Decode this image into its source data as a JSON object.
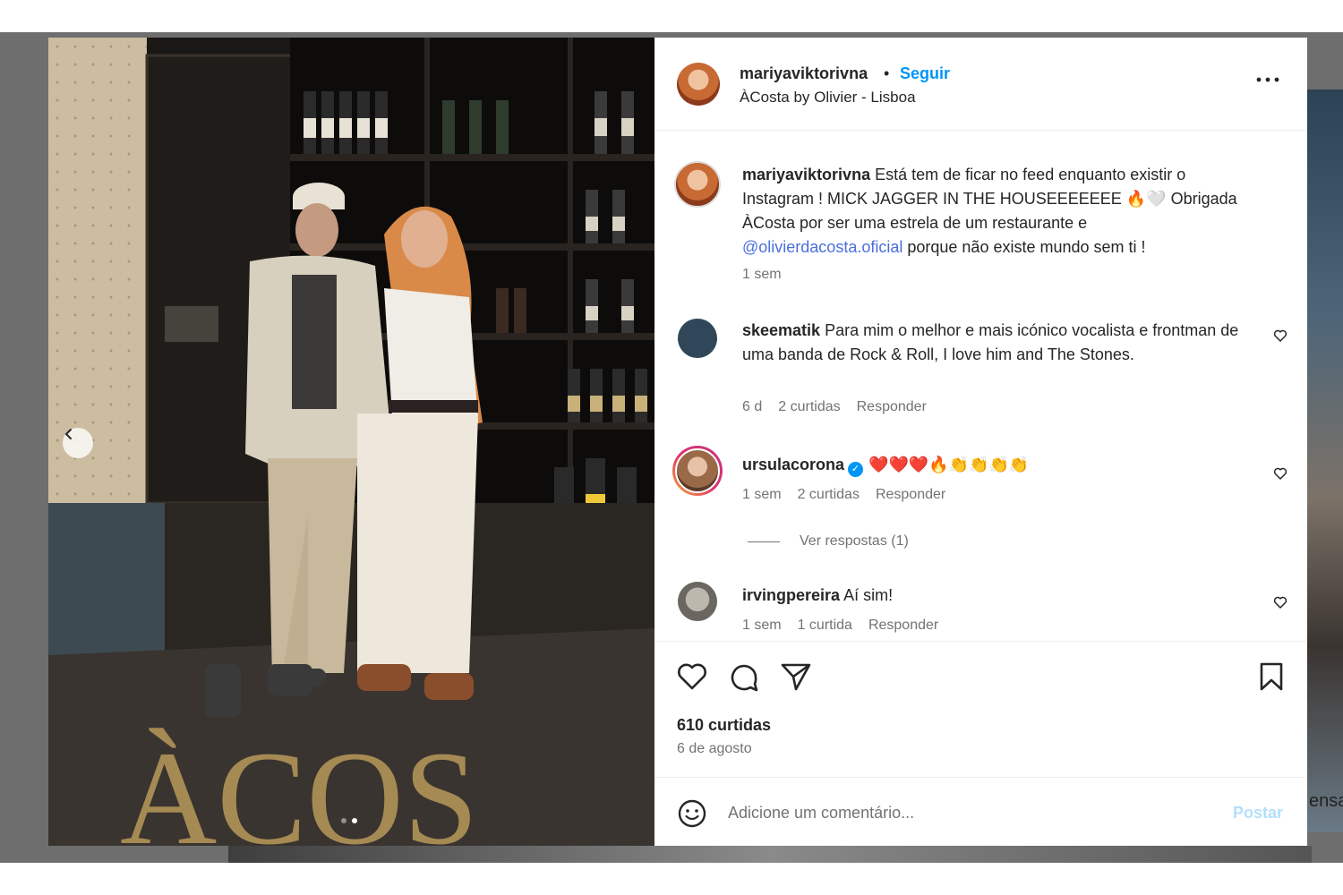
{
  "post": {
    "username": "mariyaviktorivna",
    "separator": "•",
    "follow_label": "Seguir",
    "location": "ÀCosta by Olivier - Lisboa",
    "more_icon": "more-horizontal-icon",
    "photo_sign_text": "ÀCOS",
    "carousel_total": 2,
    "carousel_active": 2
  },
  "caption": {
    "username": "mariyaviktorivna",
    "text_1": "Está tem de ficar no feed enquanto existir o Instagram ! MICK JAGGER IN THE HOUSEEEEEEE 🔥🤍 Obrigada ÀCosta por ser uma estrela de um restaurante e",
    "mention": "@olivierdacosta.oficial",
    "text_2": "porque não existe mundo sem ti !",
    "time": "1 sem"
  },
  "comments": [
    {
      "username": "skeematik",
      "text": "Para mim o melhor e mais icónico vocalista e frontman de uma banda de Rock & Roll, I love him and The Stones.",
      "time": "6 d",
      "likes": "2 curtidas",
      "reply": "Responder"
    },
    {
      "username": "ursulacorona",
      "verified": true,
      "text": "❤️❤️❤️🔥👏👏👏👏",
      "time": "1 sem",
      "likes": "2 curtidas",
      "reply": "Responder",
      "view_replies": "Ver respostas (1)"
    },
    {
      "username": "irvingpereira",
      "text": "Aí sim!",
      "time": "1 sem",
      "likes": "1 curtida",
      "reply": "Responder"
    }
  ],
  "actions": {
    "like_icon": "heart-icon",
    "comment_icon": "comment-icon",
    "share_icon": "send-icon",
    "save_icon": "bookmark-icon",
    "likes_count": "610 curtidas",
    "date": "6 de agosto"
  },
  "composer": {
    "emoji_icon": "emoji-icon",
    "placeholder": "Adicione um comentário...",
    "post_label": "Postar"
  },
  "colors": {
    "accent": "#0095f6",
    "mention": "#4a6fdc",
    "muted_text": "#737373",
    "text": "#262626",
    "post_disabled": "#b2dffc"
  },
  "background": {
    "partial_text": "ensa"
  }
}
